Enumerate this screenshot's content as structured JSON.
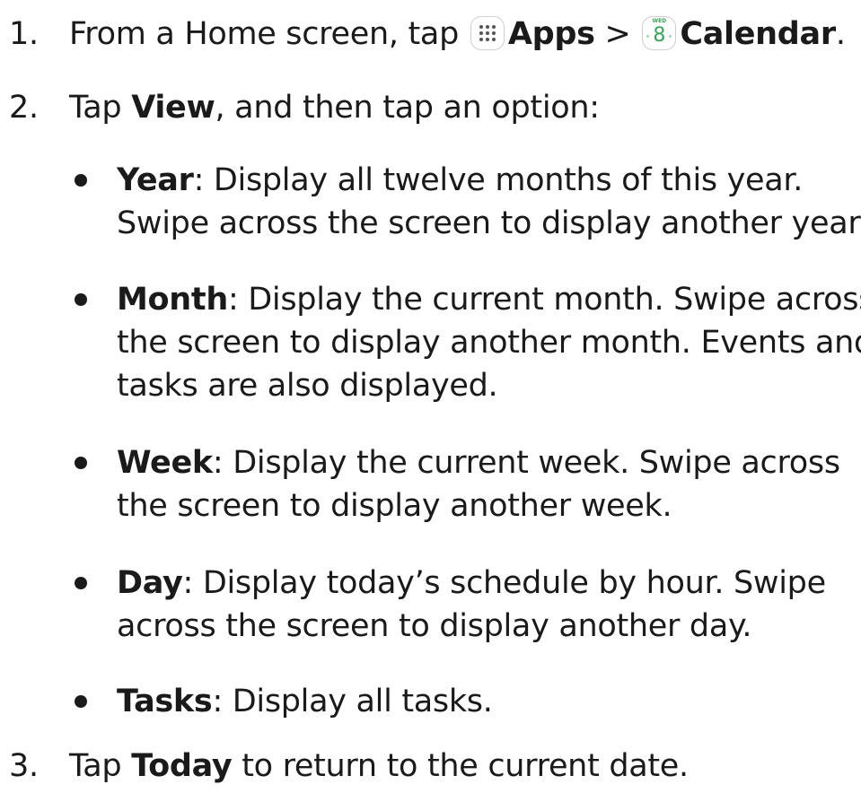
{
  "steps": [
    {
      "number": "1.",
      "pre": "From a Home screen, tap",
      "apps_label": "Apps",
      "separator": ">",
      "calendar_day": "WED",
      "calendar_date": "8",
      "calendar_label": "Calendar",
      "end": "."
    },
    {
      "number": "2.",
      "pre": "Tap ",
      "bold": "View",
      "post": ", and then tap an option:"
    },
    {
      "number": "3.",
      "pre": "Tap ",
      "bold": "Today",
      "post": " to return to the current date."
    }
  ],
  "options": [
    {
      "label": "Year",
      "lines": [
        ": Display all twelve months of this year.",
        "Swipe across the screen to display another year."
      ]
    },
    {
      "label": "Month",
      "lines": [
        ": Display the current month. Swipe across",
        "the screen to display another month. Events and",
        "tasks are also displayed."
      ]
    },
    {
      "label": "Week",
      "lines": [
        ": Display the current week. Swipe across",
        "the screen to display another week."
      ]
    },
    {
      "label": "Day",
      "lines": [
        ": Display today’s schedule by hour. Swipe",
        "across the screen to display another day."
      ]
    },
    {
      "label": "Tasks",
      "lines": [
        ": Display all tasks."
      ]
    }
  ],
  "icons": {
    "apps": "apps-grid-icon",
    "calendar": "calendar-icon",
    "bullet": "bullet-dot"
  },
  "colors": {
    "text": "#1a1a1a",
    "calendar_accent": "#3aa35a"
  }
}
